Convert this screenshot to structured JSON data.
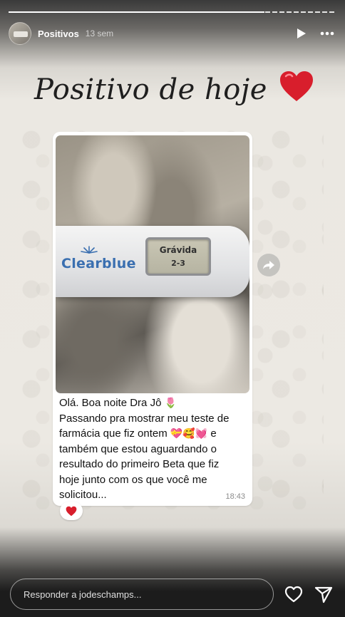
{
  "story": {
    "username": "Positivos",
    "time_ago": "13 sem",
    "progress_fraction": 0.78,
    "caption": "Positivo de hoje",
    "caption_emoji": "red-heart"
  },
  "message": {
    "photo_brand": "Clearblue",
    "test_line1": "Grávida",
    "test_line2": "2-3",
    "line1": "Olá. Boa noite Dra Jô",
    "line1_emoji": "🌷",
    "line2": "Passando pra mostrar meu teste de",
    "line3": "farmácia que fiz ontem",
    "line3_emojis": "💝🥰💓",
    "line3_end": "e",
    "line4": "também que estou aguardando o",
    "line5": "resultado do primeiro Beta que fiz",
    "line6": "hoje junto com os que você me",
    "line7": "solicitou...",
    "timestamp": "18:43",
    "reaction": "❤️"
  },
  "reply": {
    "placeholder": "Responder a jodeschamps..."
  },
  "colors": {
    "heart": "#d81e2c",
    "brand": "#3a6fb0"
  },
  "icons": [
    "play-icon",
    "more-icon",
    "share-icon",
    "like-icon",
    "send-icon"
  ]
}
